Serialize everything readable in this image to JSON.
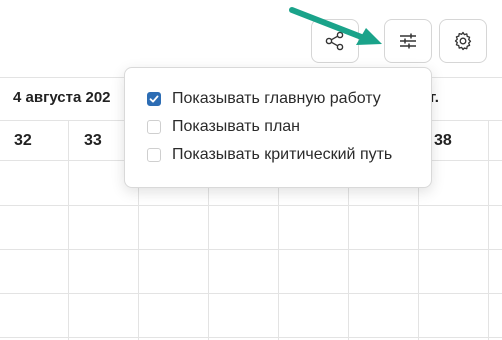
{
  "toolbar": {
    "share_icon": "share-icon",
    "display_icon": "sliders-icon",
    "settings_icon": "gear-icon"
  },
  "timeline": {
    "date_left": "4 августа 202",
    "date_right": "г.",
    "weeks": [
      "32",
      "33",
      "38"
    ]
  },
  "display_menu": {
    "options": [
      {
        "label": "Показывать главную работу",
        "checked": true
      },
      {
        "label": "Показывать план",
        "checked": false
      },
      {
        "label": "Показывать критический путь",
        "checked": false
      }
    ]
  },
  "colors": {
    "accent": "#2d6db4",
    "annotation_arrow": "#1aa38a"
  }
}
